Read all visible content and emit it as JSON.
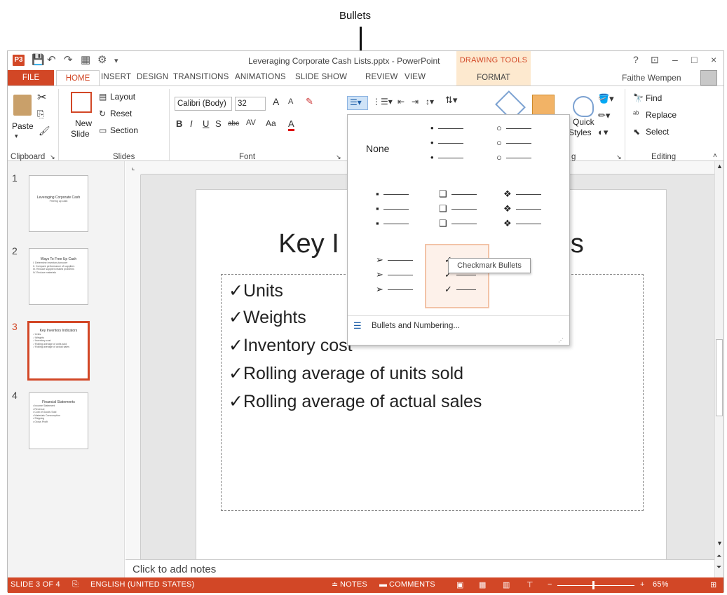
{
  "callout": "Bullets",
  "titlebar": {
    "app_icon_text": "P3",
    "title": "Leveraging Corporate Cash Lists.pptx - PowerPoint",
    "drawing_tools": "DRAWING TOOLS",
    "help": "?",
    "minimize": "–",
    "maximize": "□",
    "close": "×"
  },
  "tabs": [
    "FILE",
    "HOME",
    "INSERT",
    "DESIGN",
    "TRANSITIONS",
    "ANIMATIONS",
    "SLIDE SHOW",
    "REVIEW",
    "VIEW",
    "FORMAT"
  ],
  "user": "Faithe Wempen",
  "ribbon": {
    "paste": "Paste",
    "new_slide": "New",
    "new_slide2": "Slide",
    "layout": "Layout",
    "reset": "Reset",
    "section": "Section",
    "font_name": "Calibri (Body)",
    "font_size": "32",
    "groups": {
      "clipboard": "Clipboard",
      "slides": "Slides",
      "font": "Font",
      "drawing": "g",
      "editing": "Editing"
    },
    "find": "Find",
    "replace": "Replace",
    "select": "Select",
    "quick_styles": "Quick",
    "quick_styles2": "Styles"
  },
  "slides": [
    {
      "num": "1",
      "title": "Leveraging Corporate Cash",
      "lines": [
        "Freeing up cash"
      ]
    },
    {
      "num": "2",
      "title": "Ways To Free Up Cash",
      "lines": [
        "I. Determine inventory turnover",
        "II. Compare performance of suppliers",
        "III. Reduce supplier-related problems",
        "IV. Reduce materials"
      ]
    },
    {
      "num": "3",
      "title": "Key Inventory Indicators",
      "lines": [
        "✓Units",
        "✓Weights",
        "✓Inventory cost",
        "✓Rolling average of units sold",
        "✓Rolling average of actual sales"
      ]
    },
    {
      "num": "4",
      "title": "Financial Statements",
      "lines": [
        "• Income Statement",
        "• Revenue",
        "• Cost of Goods Sold",
        "• Materials Consumption",
        "• Shipping",
        "• Gross Profit"
      ]
    }
  ],
  "slide": {
    "title_left": "Key I",
    "title_right": "s",
    "bullets": [
      "✓Units",
      "✓Weights",
      "✓Inventory cost",
      "✓Rolling average of units sold",
      "✓Rolling average of actual sales"
    ]
  },
  "notes": "Click to add notes",
  "statusbar": {
    "slide_of": "SLIDE 3 OF 4",
    "language": "ENGLISH (UNITED STATES)",
    "notes": "NOTES",
    "comments": "COMMENTS",
    "zoom": "65%"
  },
  "bullet_menu": {
    "none_label": "None",
    "footer": "Bullets and Numbering...",
    "tooltip": "Checkmark Bullets"
  }
}
